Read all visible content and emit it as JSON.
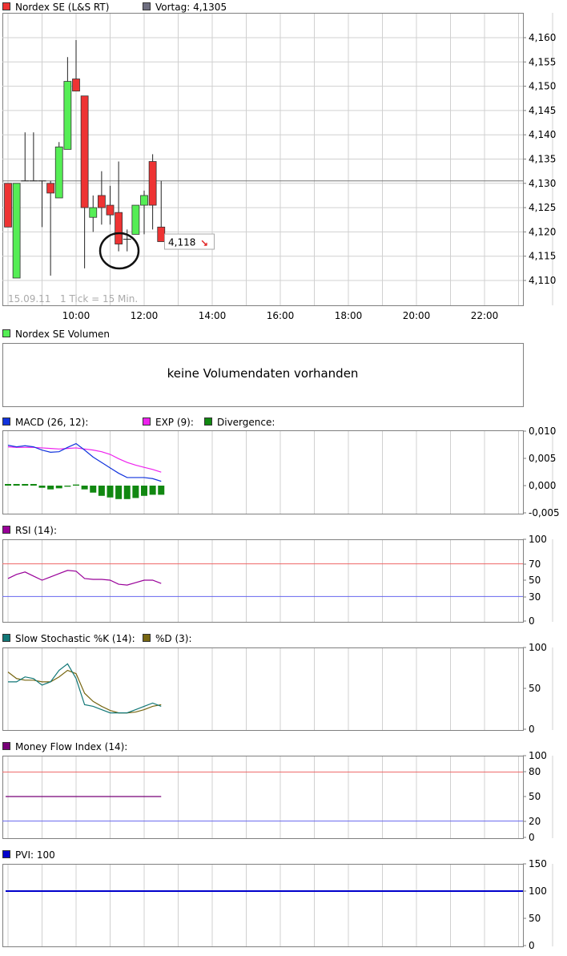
{
  "colors": {
    "grid": "#d0d0d0",
    "frame": "#7f7f7f",
    "up": "#55ee55",
    "down": "#ee3333",
    "macd": "#1133dd",
    "exp": "#ee22ee",
    "divergence": "#118811",
    "rsi": "#990099",
    "stoch_k": "#117777",
    "stoch_d": "#776611",
    "mfi": "#770077",
    "pvi": "#0000cc",
    "level_high": "#ee6666",
    "level_low": "#6666ee",
    "vortag_icon": "#6e6e80"
  },
  "chart_data": [
    {
      "type": "candlestick",
      "legend": [
        {
          "label": "Nordex SE (L&S RT)",
          "color": "#ee3333"
        },
        {
          "label": "Vortag: 4,1305",
          "color": "#6e6e80"
        }
      ],
      "date_label": "15.09.11",
      "interval_label": "1 Tick = 15 Min.",
      "x_ticks": [
        "10:00",
        "12:00",
        "14:00",
        "16:00",
        "18:00",
        "20:00",
        "22:00"
      ],
      "y_ticks": [
        "4,160",
        "4,155",
        "4,150",
        "4,145",
        "4,140",
        "4,135",
        "4,130",
        "4,125",
        "4,120",
        "4,115",
        "4,110"
      ],
      "ylim": [
        4.1075,
        4.1635
      ],
      "previous_close": 4.1305,
      "last_price_label": "4,118",
      "candles": [
        {
          "time": "09:00",
          "open": 4.13,
          "high": 4.13,
          "low": 4.121,
          "close": 4.121
        },
        {
          "time": "09:15",
          "open": 4.1105,
          "high": 4.13,
          "low": 4.1105,
          "close": 4.13
        },
        {
          "time": "09:30",
          "open": 4.1305,
          "high": 4.1405,
          "low": 4.1305,
          "close": 4.1305
        },
        {
          "time": "09:45",
          "open": 4.1305,
          "high": 4.1405,
          "low": 4.1305,
          "close": 4.1305
        },
        {
          "time": "10:00",
          "open": 4.1305,
          "high": 4.1305,
          "low": 4.121,
          "close": 4.1305
        },
        {
          "time": "10:15",
          "open": 4.13,
          "high": 4.1305,
          "low": 4.111,
          "close": 4.128
        },
        {
          "time": "10:30",
          "open": 4.127,
          "high": 4.1385,
          "low": 4.127,
          "close": 4.1375
        },
        {
          "time": "10:45",
          "open": 4.137,
          "high": 4.156,
          "low": 4.137,
          "close": 4.151
        },
        {
          "time": "11:00",
          "open": 4.1515,
          "high": 4.1595,
          "low": 4.149,
          "close": 4.149
        },
        {
          "time": "11:15",
          "open": 4.148,
          "high": 4.148,
          "low": 4.1125,
          "close": 4.125
        },
        {
          "time": "11:30",
          "open": 4.123,
          "high": 4.1275,
          "low": 4.12,
          "close": 4.125
        },
        {
          "time": "11:45",
          "open": 4.1275,
          "high": 4.1325,
          "low": 4.1215,
          "close": 4.125
        },
        {
          "time": "12:00",
          "open": 4.1255,
          "high": 4.1295,
          "low": 4.1215,
          "close": 4.1235
        },
        {
          "time": "12:15",
          "open": 4.124,
          "high": 4.1345,
          "low": 4.116,
          "close": 4.1175
        },
        {
          "time": "12:30",
          "open": 4.1185,
          "high": 4.1205,
          "low": 4.116,
          "close": 4.1185
        },
        {
          "time": "12:45",
          "open": 4.1195,
          "high": 4.1255,
          "low": 4.1195,
          "close": 4.1255
        },
        {
          "time": "13:00",
          "open": 4.1255,
          "high": 4.1285,
          "low": 4.1195,
          "close": 4.1275
        },
        {
          "time": "13:15",
          "open": 4.1345,
          "high": 4.136,
          "low": 4.1205,
          "close": 4.1255
        },
        {
          "time": "13:30",
          "open": 4.121,
          "high": 4.1305,
          "low": 4.118,
          "close": 4.118
        }
      ]
    },
    {
      "type": "bar",
      "legend": [
        {
          "label": "Nordex SE Volumen",
          "color": "#55ee55"
        }
      ],
      "message": "keine Volumendaten vorhanden"
    },
    {
      "type": "line",
      "legend": [
        {
          "label": "MACD (26, 12):",
          "color": "#1133dd"
        },
        {
          "label": "EXP (9):",
          "color": "#ee22ee"
        },
        {
          "label": "Divergence:",
          "color": "#118811"
        }
      ],
      "y_ticks": [
        "0,010",
        "0,005",
        "0,000",
        "-0,005"
      ],
      "ylim": [
        -0.0055,
        0.0103
      ],
      "x": [
        "09:00",
        "09:15",
        "09:30",
        "09:45",
        "10:00",
        "10:15",
        "10:30",
        "10:45",
        "11:00",
        "11:15",
        "11:30",
        "11:45",
        "12:00",
        "12:15",
        "12:30",
        "12:45",
        "13:00",
        "13:15",
        "13:30"
      ],
      "series": [
        {
          "name": "MACD (26, 12):",
          "type": "line",
          "values": [
            0.0075,
            0.0072,
            0.0074,
            0.0072,
            0.0066,
            0.0062,
            0.0063,
            0.0071,
            0.0078,
            0.0066,
            0.0053,
            0.0043,
            0.0033,
            0.0023,
            0.0015,
            0.0015,
            0.0015,
            0.0013,
            0.0008
          ]
        },
        {
          "name": "EXP (9):",
          "type": "line",
          "values": [
            0.0072,
            0.0071,
            0.0071,
            0.0071,
            0.007,
            0.0069,
            0.0068,
            0.0069,
            0.007,
            0.0068,
            0.0066,
            0.0063,
            0.0058,
            0.005,
            0.0043,
            0.0038,
            0.0034,
            0.003,
            0.0025
          ]
        },
        {
          "name": "Divergence:",
          "type": "bar",
          "values": [
            0.0003,
            0.0003,
            0.0003,
            0.0003,
            -0.0004,
            -0.0007,
            -0.0005,
            -0.0002,
            0.0002,
            -0.0007,
            -0.0013,
            -0.0019,
            -0.0022,
            -0.0025,
            -0.0025,
            -0.0023,
            -0.0019,
            -0.0017,
            -0.0017
          ]
        }
      ]
    },
    {
      "type": "line",
      "legend": [
        {
          "label": "RSI (14):",
          "color": "#990099"
        }
      ],
      "y_ticks": [
        "100",
        "70",
        "50",
        "30",
        "0"
      ],
      "ylim": [
        0,
        100
      ],
      "levels": [
        70,
        30
      ],
      "x": [
        "09:00",
        "09:15",
        "09:30",
        "09:45",
        "10:00",
        "10:15",
        "10:30",
        "10:45",
        "11:00",
        "11:15",
        "11:30",
        "11:45",
        "12:00",
        "12:15",
        "12:30",
        "12:45",
        "13:00",
        "13:15",
        "13:30"
      ],
      "series": [
        {
          "name": "RSI (14):",
          "values": [
            52,
            57,
            60,
            55,
            50,
            54,
            58,
            62,
            61,
            52,
            51,
            51,
            50,
            45,
            44,
            47,
            50,
            50,
            46
          ]
        }
      ]
    },
    {
      "type": "line",
      "legend": [
        {
          "label": "Slow Stochastic %K (14):",
          "color": "#117777"
        },
        {
          "label": "%D (3):",
          "color": "#776611"
        }
      ],
      "y_ticks": [
        "100",
        "50",
        "0"
      ],
      "ylim": [
        0,
        100
      ],
      "x": [
        "09:00",
        "09:15",
        "09:30",
        "09:45",
        "10:00",
        "10:15",
        "10:30",
        "10:45",
        "11:00",
        "11:15",
        "11:30",
        "11:45",
        "12:00",
        "12:15",
        "12:30",
        "12:45",
        "13:00",
        "13:15",
        "13:30"
      ],
      "series": [
        {
          "name": "Slow Stochastic %K (14):",
          "values": [
            58,
            58,
            64,
            62,
            54,
            58,
            72,
            80,
            62,
            30,
            28,
            24,
            20,
            20,
            20,
            24,
            28,
            32,
            28
          ]
        },
        {
          "name": "%D (3):",
          "values": [
            70,
            62,
            60,
            60,
            58,
            58,
            64,
            72,
            68,
            44,
            34,
            28,
            23,
            20,
            20,
            21,
            24,
            28,
            30
          ]
        }
      ]
    },
    {
      "type": "line",
      "legend": [
        {
          "label": "Money Flow Index (14):",
          "color": "#770077"
        }
      ],
      "y_ticks": [
        "100",
        "80",
        "50",
        "20",
        "0"
      ],
      "ylim": [
        0,
        100
      ],
      "levels": [
        80,
        20
      ],
      "x": [
        "09:00",
        "13:30"
      ],
      "series": [
        {
          "name": "Money Flow Index (14):",
          "values": [
            50,
            50
          ]
        }
      ]
    },
    {
      "type": "line",
      "legend": [
        {
          "label": "PVI: 100",
          "color": "#0000cc"
        }
      ],
      "y_ticks": [
        "150",
        "100",
        "50",
        "0"
      ],
      "ylim": [
        0,
        150
      ],
      "x": [
        "09:00",
        "23:30"
      ],
      "series": [
        {
          "name": "PVI: 100",
          "values": [
            100,
            100
          ]
        }
      ]
    }
  ]
}
